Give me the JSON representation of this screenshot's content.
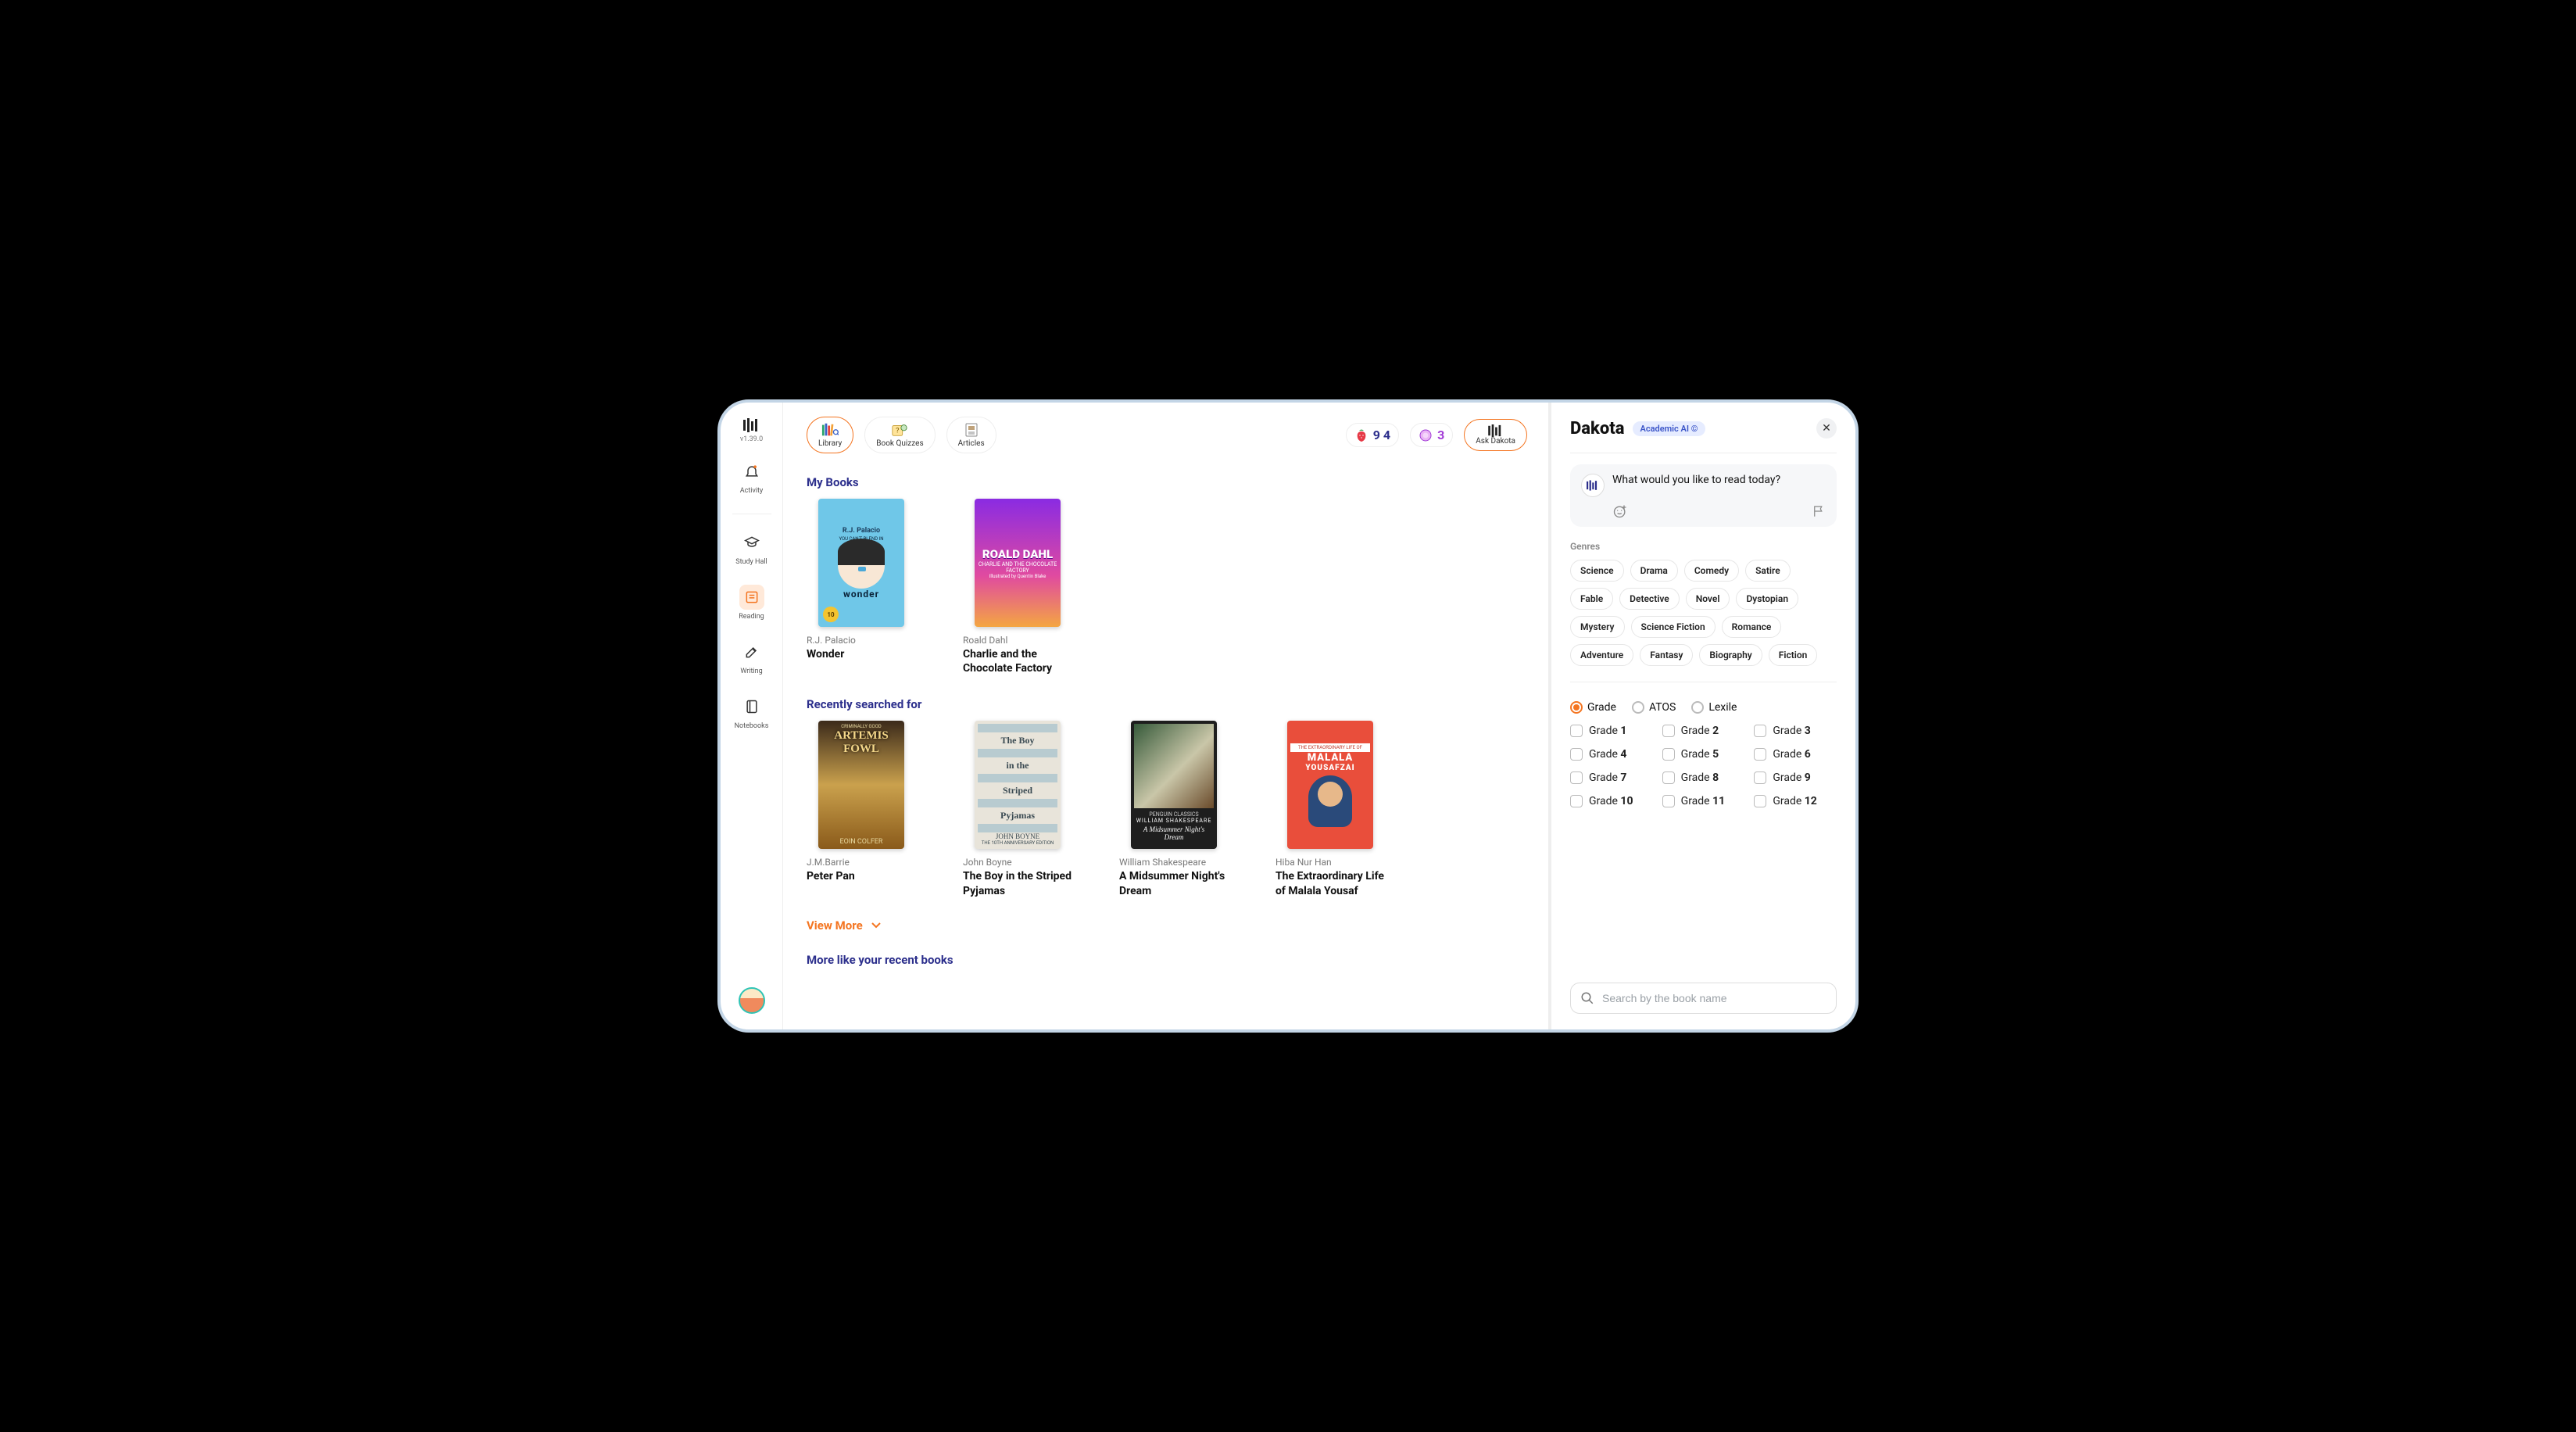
{
  "app": {
    "version": "v1.39.0"
  },
  "sidebar": {
    "items": [
      {
        "label": "Activity"
      },
      {
        "label": "Study Hall"
      },
      {
        "label": "Reading"
      },
      {
        "label": "Writing"
      },
      {
        "label": "Notebooks"
      }
    ]
  },
  "topbar": {
    "tabs": [
      {
        "label": "Library"
      },
      {
        "label": "Book Quizzes"
      },
      {
        "label": "Articles"
      }
    ],
    "streak": "9 4",
    "badges": "3",
    "ask_label": "Ask Dakota"
  },
  "sections": {
    "my_books_title": "My Books",
    "recent_title": "Recently searched for",
    "more_like_title": "More like your recent books",
    "view_more": "View More"
  },
  "my_books": [
    {
      "author": "R.J. Palacio",
      "title": "Wonder",
      "cover_text_top": "R.J. Palacio",
      "cover_word": "wonder"
    },
    {
      "author": "Roald Dahl",
      "title": "Charlie and the Chocolate Factory",
      "cover_author": "ROALD DAHL",
      "cover_sub": "CHARLIE AND THE CHOCOLATE FACTORY"
    }
  ],
  "recent": [
    {
      "author": "J.M.Barrie",
      "title": "Peter Pan",
      "cover_line1": "ARTEMIS",
      "cover_line2": "FOWL",
      "cover_author": "EOIN COLFER"
    },
    {
      "author": "John Boyne",
      "title": "The Boy in the Striped Pyjamas",
      "cover_l1": "The Boy",
      "cover_l2": "in the",
      "cover_l3": "Striped",
      "cover_l4": "Pyjamas",
      "cover_author": "JOHN BOYNE"
    },
    {
      "author": "William Shakespeare",
      "title": "A Midsummer Night's Dream",
      "cover_pub": "PENGUIN CLASSICS",
      "cover_author": "WILLIAM SHAKESPEARE",
      "cover_title": "A Midsummer Night's Dream"
    },
    {
      "author": "Hiba Nur Han",
      "title": "The Extraordinary Life of Malala Yousaf",
      "cover_band": "THE EXTRAORDINARY LIFE OF",
      "cover_name1": "MALALA",
      "cover_name2": "YOUSAFZAI"
    }
  ],
  "panel": {
    "title": "Dakota",
    "pill": "Academic AI ©",
    "prompt": "What would you like to read today?",
    "genres_label": "Genres",
    "genres": [
      "Science",
      "Drama",
      "Comedy",
      "Satire",
      "Fable",
      "Detective",
      "Novel",
      "Dystopian",
      "Mystery",
      "Science Fiction",
      "Romance",
      "Adventure",
      "Fantasy",
      "Biography",
      "Fiction"
    ],
    "scales": [
      {
        "label": "Grade",
        "selected": true
      },
      {
        "label": "ATOS",
        "selected": false
      },
      {
        "label": "Lexile",
        "selected": false
      }
    ],
    "grade_prefix": "Grade",
    "grades": [
      "1",
      "2",
      "3",
      "4",
      "5",
      "6",
      "7",
      "8",
      "9",
      "10",
      "11",
      "12"
    ],
    "search_placeholder": "Search by the book name"
  }
}
